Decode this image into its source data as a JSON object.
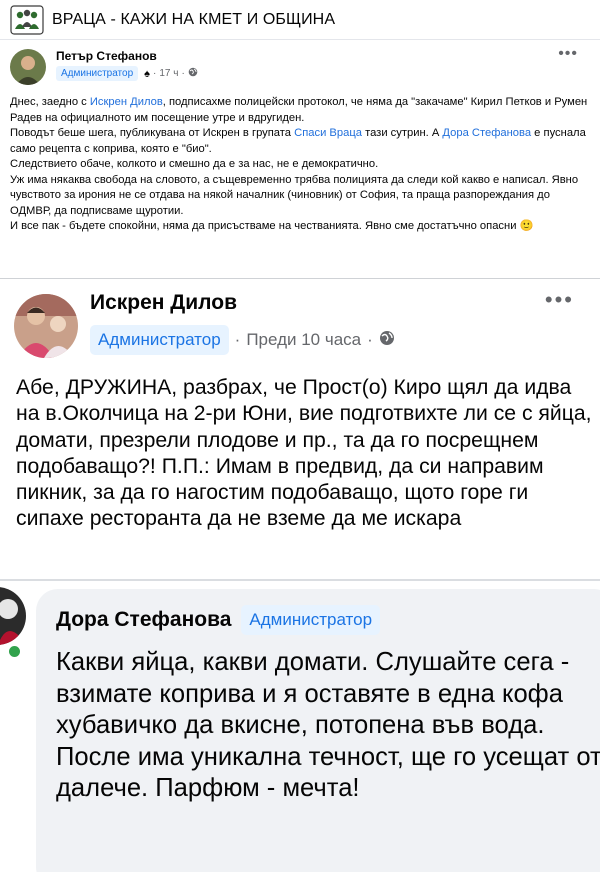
{
  "group": {
    "name": "ВРАЦА - КАЖИ НА КМЕТ И ОБЩИНА",
    "icon": "group-people-icon"
  },
  "post1": {
    "author": "Петър Стефанов",
    "badge": "Администратор",
    "time": "17 ч",
    "separator": "·",
    "paragraphs": [
      [
        {
          "t": "Днес, заедно с "
        },
        {
          "t": "Искрен Дилов",
          "link": true
        },
        {
          "t": ", подписахме полицейски протокол, че няма да \"закачаме\" Кирил Петков и Румен Радев на официалното им посещение утре и вдругиден."
        }
      ],
      [
        {
          "t": "Поводът беше шега, публикувана от Искрен в групата "
        },
        {
          "t": "Спаси Враца",
          "link": true
        },
        {
          "t": " тази сутрин. А "
        },
        {
          "t": "Дора Стефанова",
          "link": true
        },
        {
          "t": " е пуснала само рецепта с коприва, която е \"био\"."
        }
      ],
      [
        {
          "t": "Следствието обаче, колкото и смешно да е за нас, не е демократично."
        }
      ],
      [
        {
          "t": "Уж има някаква свобода на словото, а същевременно трябва полицията да следи кой какво е написал. Явно чувството за ирония не се отдава на някой началник (чиновник) от София, та праща разпореждания до ОДМВР, да подписваме щуротии."
        }
      ],
      [
        {
          "t": "И все пак - бъдете спокойни, няма да присъстваме на честванията. Явно сме достатъчно опасни "
        },
        {
          "t": "🙂",
          "emoji": true
        }
      ]
    ]
  },
  "post2": {
    "author": "Искрен Дилов",
    "badge": "Администратор",
    "time": "Преди 10 часа",
    "separator": "·",
    "text": "Абе, ДРУЖИНА, разбрах, че Прост(о) Киро щял да идва на в.Околчица на 2-ри Юни, вие подготвихте ли се с яйца, домати, презрели плодове и пр., та да го посрещнем подобаващо?! П.П.: Имам в предвид, да си направим пикник, за да го нагостим подобаващо, щото горе ги сипахе ресторанта да не вземе да ме искара"
  },
  "comment": {
    "author": "Дора Стефанова",
    "badge": "Администратор",
    "text": "Какви яйца, какви домати. Слушайте сега - взимате коприва и я оставяте в една кофа хубавичко да вкисне, потопена във вода. После има уникална течност, ще го усещат от далече. Парфюм - мечта!"
  },
  "colors": {
    "link": "#216fdb",
    "badge_bg": "#e7f3ff",
    "badge_text": "#1b74e4",
    "online": "#31a24c",
    "bubble": "#f0f2f5"
  }
}
